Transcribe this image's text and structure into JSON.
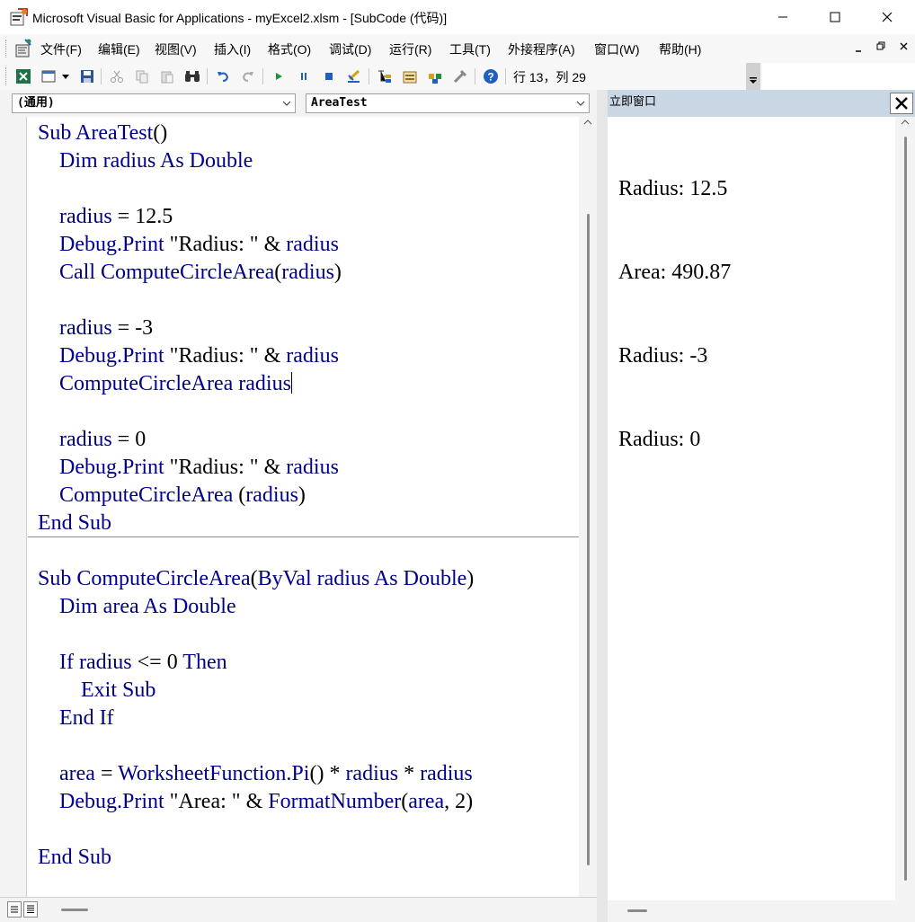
{
  "window": {
    "title": "Microsoft Visual Basic for Applications - myExcel2.xlsm - [SubCode (代码)]"
  },
  "menu": {
    "items": [
      "文件(F)",
      "编辑(E)",
      "视图(V)",
      "插入(I)",
      "格式(O)",
      "调试(D)",
      "运行(R)",
      "工具(T)",
      "外接程序(A)",
      "窗口(W)",
      "帮助(H)"
    ]
  },
  "toolbar": {
    "position_text": "行 13，列 29",
    "icons": [
      "excel-icon",
      "insert-userform-icon",
      "save-icon",
      "cut-icon",
      "copy-icon",
      "paste-icon",
      "find-icon",
      "undo-icon",
      "redo-icon",
      "run-icon",
      "break-icon",
      "reset-icon",
      "design-mode-icon",
      "project-explorer-icon",
      "properties-icon",
      "object-browser-icon",
      "toolbox-icon",
      "help-icon"
    ]
  },
  "code_window": {
    "object_combo": "(通用)",
    "procedure_combo": "AreaTest",
    "lines": [
      [
        {
          "t": "Sub AreaTest",
          "c": "kw"
        },
        {
          "t": "()",
          "c": "pl"
        }
      ],
      [
        {
          "t": "    Dim radius As Double",
          "c": "kw"
        }
      ],
      [],
      [
        {
          "t": "    radius",
          "c": "kw"
        },
        {
          "t": " = 12.5",
          "c": "pl"
        }
      ],
      [
        {
          "t": "    Debug.Print",
          "c": "kw"
        },
        {
          "t": " \"Radius: \" & ",
          "c": "pl"
        },
        {
          "t": "radius",
          "c": "kw"
        }
      ],
      [
        {
          "t": "    Call ComputeCircleArea",
          "c": "kw"
        },
        {
          "t": "(",
          "c": "pl"
        },
        {
          "t": "radius",
          "c": "kw"
        },
        {
          "t": ")",
          "c": "pl"
        }
      ],
      [],
      [
        {
          "t": "    radius",
          "c": "kw"
        },
        {
          "t": " = -3",
          "c": "pl"
        }
      ],
      [
        {
          "t": "    Debug.Print",
          "c": "kw"
        },
        {
          "t": " \"Radius: \" & ",
          "c": "pl"
        },
        {
          "t": "radius",
          "c": "kw"
        }
      ],
      [
        {
          "t": "    ComputeCircleArea radius",
          "c": "kw"
        },
        {
          "t": "",
          "c": "caret"
        }
      ],
      [],
      [
        {
          "t": "    radius",
          "c": "kw"
        },
        {
          "t": " = 0",
          "c": "pl"
        }
      ],
      [
        {
          "t": "    Debug.Print",
          "c": "kw"
        },
        {
          "t": " \"Radius: \" & ",
          "c": "pl"
        },
        {
          "t": "radius",
          "c": "kw"
        }
      ],
      [
        {
          "t": "    ComputeCircleArea",
          "c": "kw"
        },
        {
          "t": " (",
          "c": "pl"
        },
        {
          "t": "radius",
          "c": "kw"
        },
        {
          "t": ")",
          "c": "pl"
        }
      ],
      [
        {
          "t": "End Sub",
          "c": "kw"
        }
      ],
      [],
      [
        {
          "t": "Sub ComputeCircleArea",
          "c": "kw"
        },
        {
          "t": "(",
          "c": "pl"
        },
        {
          "t": "ByVal radius As Double",
          "c": "kw"
        },
        {
          "t": ")",
          "c": "pl"
        }
      ],
      [
        {
          "t": "    Dim area As Double",
          "c": "kw"
        }
      ],
      [],
      [
        {
          "t": "    If radius",
          "c": "kw"
        },
        {
          "t": " <= 0 ",
          "c": "pl"
        },
        {
          "t": "Then",
          "c": "kw"
        }
      ],
      [
        {
          "t": "        Exit Sub",
          "c": "kw"
        }
      ],
      [
        {
          "t": "    End If",
          "c": "kw"
        }
      ],
      [],
      [
        {
          "t": "    area",
          "c": "kw"
        },
        {
          "t": " = ",
          "c": "pl"
        },
        {
          "t": "WorksheetFunction.Pi",
          "c": "kw"
        },
        {
          "t": "() * ",
          "c": "pl"
        },
        {
          "t": "radius",
          "c": "kw"
        },
        {
          "t": " * ",
          "c": "pl"
        },
        {
          "t": "radius",
          "c": "kw"
        }
      ],
      [
        {
          "t": "    Debug.Print",
          "c": "kw"
        },
        {
          "t": " \"Area: \" & ",
          "c": "pl"
        },
        {
          "t": "FormatNumber",
          "c": "kw"
        },
        {
          "t": "(",
          "c": "pl"
        },
        {
          "t": "area",
          "c": "kw"
        },
        {
          "t": ", 2)",
          "c": "pl"
        }
      ],
      [],
      [
        {
          "t": "End Sub",
          "c": "kw"
        }
      ]
    ]
  },
  "immediate_window": {
    "title": "立即窗口",
    "lines": [
      "Radius: 12.5",
      "Area: 490.87",
      "Radius: -3",
      "Radius: 0"
    ]
  },
  "colors": {
    "keyword": "#00008b",
    "plain": "#000000",
    "pane_title_bg": "#c9d6e4"
  }
}
